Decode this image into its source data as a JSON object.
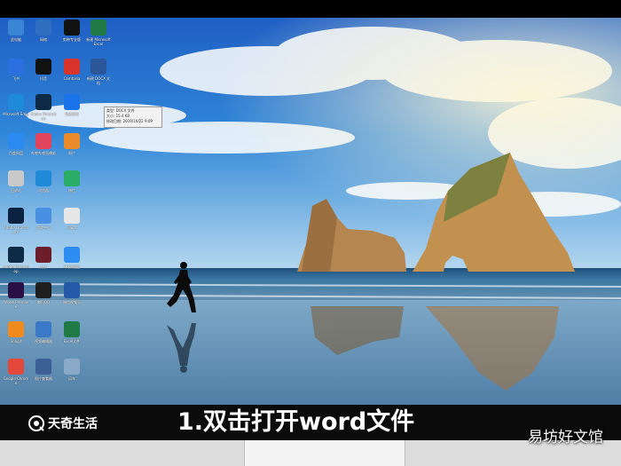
{
  "caption": {
    "brand": "天奇生活",
    "main": "1.双击打开word文件",
    "watermark": "易坊好文馆"
  },
  "tooltip": {
    "lines": [
      "类型: DOCX 文件",
      "大小: 15.4 KB",
      "修改日期: 2019/10/22 9:09"
    ]
  },
  "desktop_icons": [
    {
      "label": "此电脑",
      "icon": "computer-icon",
      "color": "#3a86d4"
    },
    {
      "label": "网络",
      "icon": "network-icon",
      "color": "#2f6fc0"
    },
    {
      "label": "剪映专业版",
      "icon": "capcut-icon",
      "color": "#111111"
    },
    {
      "label": "新建 Microsoft Excel",
      "icon": "excel-file-icon",
      "color": "#1f7a45"
    },
    {
      "label": "飞书",
      "icon": "feishu-icon",
      "color": "#2b6fe0"
    },
    {
      "label": "抖音",
      "icon": "douyin-icon",
      "color": "#111111"
    },
    {
      "label": "Camtasia",
      "icon": "camtasia-icon",
      "color": "#d9342b"
    },
    {
      "label": "新建 DOCX 文档",
      "icon": "word-file-icon",
      "color": "#2b579a"
    },
    {
      "label": "Microsoft Edge",
      "icon": "edge-icon",
      "color": "#1f8ad8"
    },
    {
      "label": "Adobe Photoshop",
      "icon": "photoshop-icon",
      "color": "#0d2a47"
    },
    {
      "label": "电脑管家",
      "icon": "pc-manager-icon",
      "color": "#1a73e8"
    },
    {
      "label": "百度网盘",
      "icon": "baidu-netdisk-icon",
      "color": "#2a8af0"
    },
    {
      "label": "哔哩哔哩直播姬",
      "icon": "bilibili-icon",
      "color": "#e2445c"
    },
    {
      "label": "照片",
      "icon": "photos-icon",
      "color": "#e98b2a"
    },
    {
      "label": "回收站",
      "icon": "recycle-bin-icon",
      "color": "#c9c9c9"
    },
    {
      "label": "浏览器",
      "icon": "browser-icon",
      "color": "#1f8ad8"
    },
    {
      "label": "微信",
      "icon": "wechat-icon",
      "color": "#2aae67"
    },
    {
      "label": "Adobe Lightroom",
      "icon": "lightroom-icon",
      "color": "#0b2340"
    },
    {
      "label": "游戏中心",
      "icon": "game-center-icon",
      "color": "#4a90e2"
    },
    {
      "label": "记事本",
      "icon": "notepad-icon",
      "color": "#e7e7e7"
    },
    {
      "label": "Adobe Photoshop",
      "icon": "photoshop-icon",
      "color": "#0d2a47"
    },
    {
      "label": "丸子",
      "icon": "wanzi-icon",
      "color": "#6b1d2a"
    },
    {
      "label": "QQ浏览器",
      "icon": "qq-browser-icon",
      "color": "#2d8cf0"
    },
    {
      "label": "Adobe Premiere",
      "icon": "premiere-icon",
      "color": "#2a0f45"
    },
    {
      "label": "腾讯QQ",
      "icon": "qq-icon",
      "color": "#1e1e1e"
    },
    {
      "label": "微信视频号",
      "icon": "video-app-icon",
      "color": "#245aa8"
    },
    {
      "label": "Snagit",
      "icon": "snagit-icon",
      "color": "#f08a1c"
    },
    {
      "label": "视频编辑器",
      "icon": "video-editor-icon",
      "color": "#3a78c8"
    },
    {
      "label": "Excel文件",
      "icon": "excel-file-icon",
      "color": "#1f7a45"
    },
    {
      "label": "Google Chrome",
      "icon": "chrome-icon",
      "color": "#e3483a"
    },
    {
      "label": "图片查看器",
      "icon": "image-viewer-icon",
      "color": "#3c5f95"
    },
    {
      "label": "风车",
      "icon": "pinwheel-icon",
      "color": "#8aa8c8"
    }
  ],
  "colors": {
    "sky_top": "#1f5fc4",
    "sky_mid": "#2f86d8",
    "sky_low": "#9ac6e8",
    "sea": "#2b5d86",
    "sand": "#6b8fa8",
    "rock": "#b98a55",
    "caption_bg": "#0b0b0b"
  }
}
